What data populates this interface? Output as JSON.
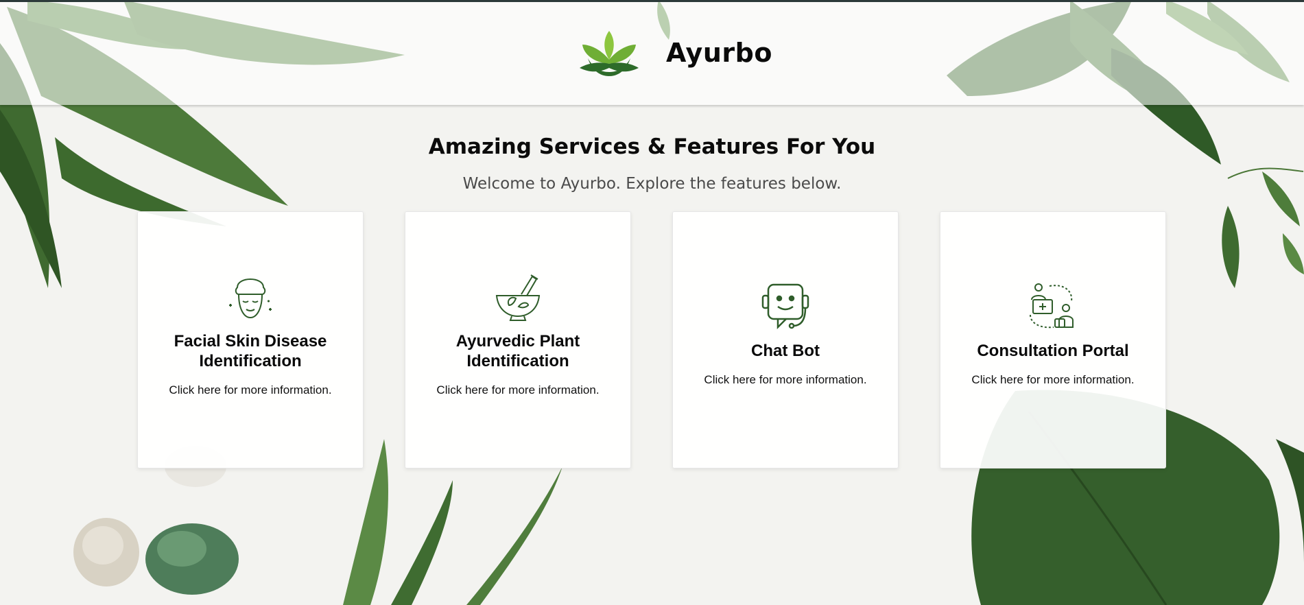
{
  "brand": {
    "name": "Ayurbo",
    "logo_icon": "lotus-logo-icon"
  },
  "main": {
    "heading": "Amazing Services & Features For You",
    "subheading": "Welcome to Ayurbo. Explore the features below."
  },
  "cards": [
    {
      "title": "Facial Skin Disease Identification",
      "text": "Click here for more information.",
      "icon": "face-skincare-icon"
    },
    {
      "title": "Ayurvedic Plant Identification",
      "text": "Click here for more information.",
      "icon": "mortar-pestle-icon"
    },
    {
      "title": "Chat Bot",
      "text": "Click here for more information.",
      "icon": "chatbot-icon"
    },
    {
      "title": "Consultation Portal",
      "text": "Click here for more information.",
      "icon": "consultation-icon"
    }
  ],
  "colors": {
    "accent_green": "#2f5d2a",
    "logo_light_green": "#8dc63f",
    "logo_dark_green": "#2d6b2a",
    "leaf_green": "#3e6b34"
  }
}
